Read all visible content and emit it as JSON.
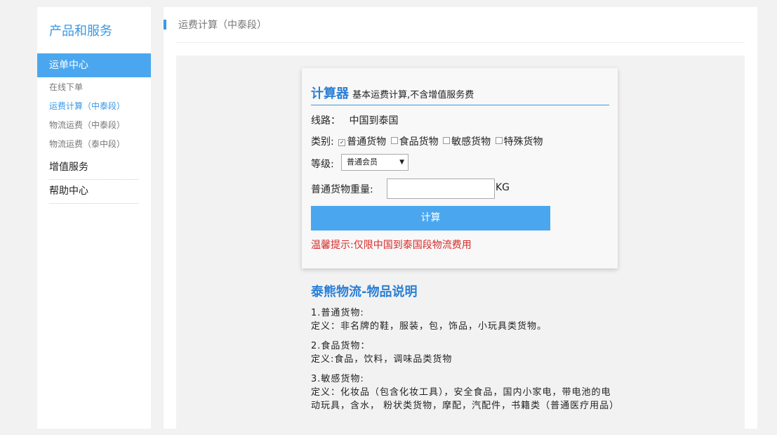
{
  "sidebar": {
    "title": "产品和服务",
    "active_item": "运单中心",
    "sub_items": [
      {
        "label": "在线下单"
      },
      {
        "label": "运费计算（中泰段）"
      },
      {
        "label": "物流运费（中泰段）"
      },
      {
        "label": "物流运费（泰中段）"
      }
    ],
    "groups": [
      {
        "label": "增值服务"
      },
      {
        "label": "帮助中心"
      }
    ]
  },
  "breadcrumb": "运费计算（中泰段）",
  "calculator": {
    "title": "计算器",
    "subtitle": "基本运费计算,不含增值服务费",
    "route_label": "线路：",
    "route_value": "中国到泰国",
    "category_label": "类别:",
    "categories": [
      {
        "label": "普通货物",
        "checked": true
      },
      {
        "label": "食品货物",
        "checked": false
      },
      {
        "label": "敏感货物",
        "checked": false
      },
      {
        "label": "特殊货物",
        "checked": false
      }
    ],
    "level_label": "等级:",
    "level_selected": "普通会员",
    "weight_label": "普通货物重量:",
    "weight_value": "",
    "weight_unit": "KG",
    "button_label": "计算",
    "tip": "温馨提示:仅限中国到泰国段物流费用"
  },
  "description": {
    "title": "泰熊物流-物品说明",
    "items": [
      {
        "heading": "1.普通货物:",
        "text": "定义：非名牌的鞋，服装，包，饰品，小玩具类货物。"
      },
      {
        "heading": "2.食品货物：",
        "text": "定义:食品，饮料，调味品类货物"
      },
      {
        "heading": "3.敏感货物:",
        "text": "定义：化妆品（包含化妆工具），安全食品，国内小家电，带电池的电动玩具，含水， 粉状类货物，摩配，汽配件，书籍类（普通医疗用品）"
      }
    ]
  },
  "colors": {
    "accent": "#4aa7ef",
    "title_blue": "#2b7fd6",
    "warning": "#d62b2b"
  }
}
